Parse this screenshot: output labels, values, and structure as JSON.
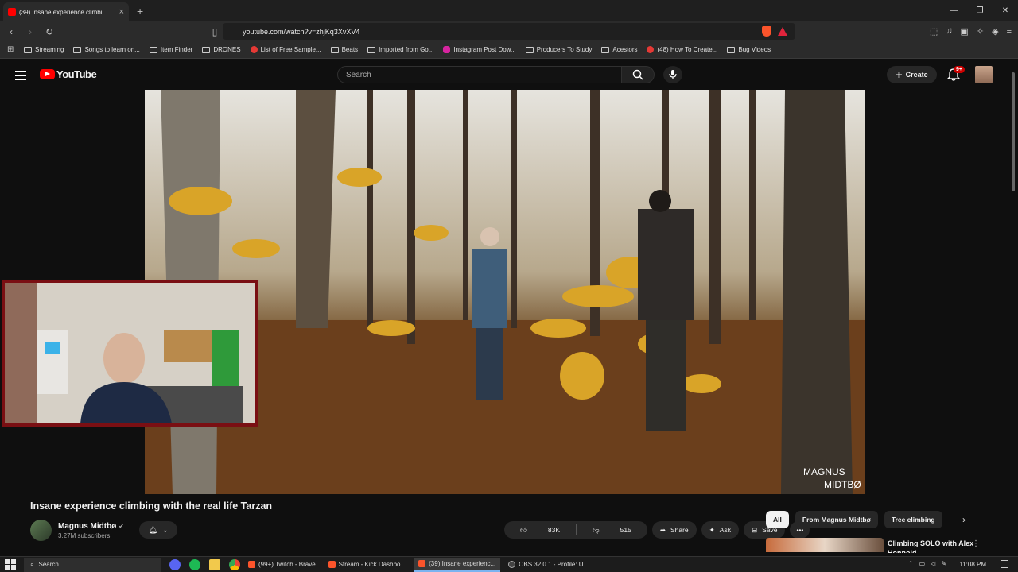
{
  "browser": {
    "tab_title": "(39) Insane experience climbi",
    "url": "youtube.com/watch?v=zhjKq3XvXV4",
    "bookmarks": [
      {
        "label": "Streaming",
        "icon": "folder-icon"
      },
      {
        "label": "Songs to learn on...",
        "icon": "folder-icon"
      },
      {
        "label": "Item Finder",
        "icon": "folder-icon"
      },
      {
        "label": "DRONES",
        "icon": "folder-icon"
      },
      {
        "label": "List of Free Sample...",
        "icon": "site-icon"
      },
      {
        "label": "Beats",
        "icon": "folder-icon"
      },
      {
        "label": "Imported from Go...",
        "icon": "folder-icon"
      },
      {
        "label": "Instagram Post Dow...",
        "icon": "instagram-icon"
      },
      {
        "label": "Producers To Study",
        "icon": "folder-icon"
      },
      {
        "label": "Acestors",
        "icon": "folder-icon"
      },
      {
        "label": "(48) How To Create...",
        "icon": "youtube-icon"
      },
      {
        "label": "Bug Videos",
        "icon": "folder-icon"
      }
    ]
  },
  "youtube": {
    "logo_text": "YouTube",
    "search_placeholder": "Search",
    "create_label": "Create",
    "notification_badge": "9+",
    "video": {
      "watermark_line1": "MAGNUS",
      "watermark_line2": "MIDTBØ",
      "title": "Insane experience climbing with the real life Tarzan"
    },
    "channel": {
      "name": "Magnus Midtbø",
      "subscribers": "3.27M subscribers"
    },
    "actions": {
      "likes": "83K",
      "dislikes": "515",
      "share": "Share",
      "ask": "Ask",
      "save": "Save"
    },
    "chips": [
      "All",
      "From Magnus Midtbø",
      "Tree climbing"
    ],
    "recommendation": {
      "title": "Climbing SOLO with Alex Honnold"
    }
  },
  "taskbar": {
    "search": "Search",
    "windows": [
      {
        "label": "(99+) Twitch - Brave",
        "active": false
      },
      {
        "label": "Stream - Kick Dashbo...",
        "active": false
      },
      {
        "label": "(39) Insane experienc...",
        "active": true
      },
      {
        "label": "OBS 32.0.1 - Profile: U...",
        "active": false
      }
    ],
    "clock": "11:08 PM"
  },
  "colors": {
    "accent": "#ff0000",
    "background": "#0f0f0f",
    "webcam_border": "#7a0f13"
  }
}
